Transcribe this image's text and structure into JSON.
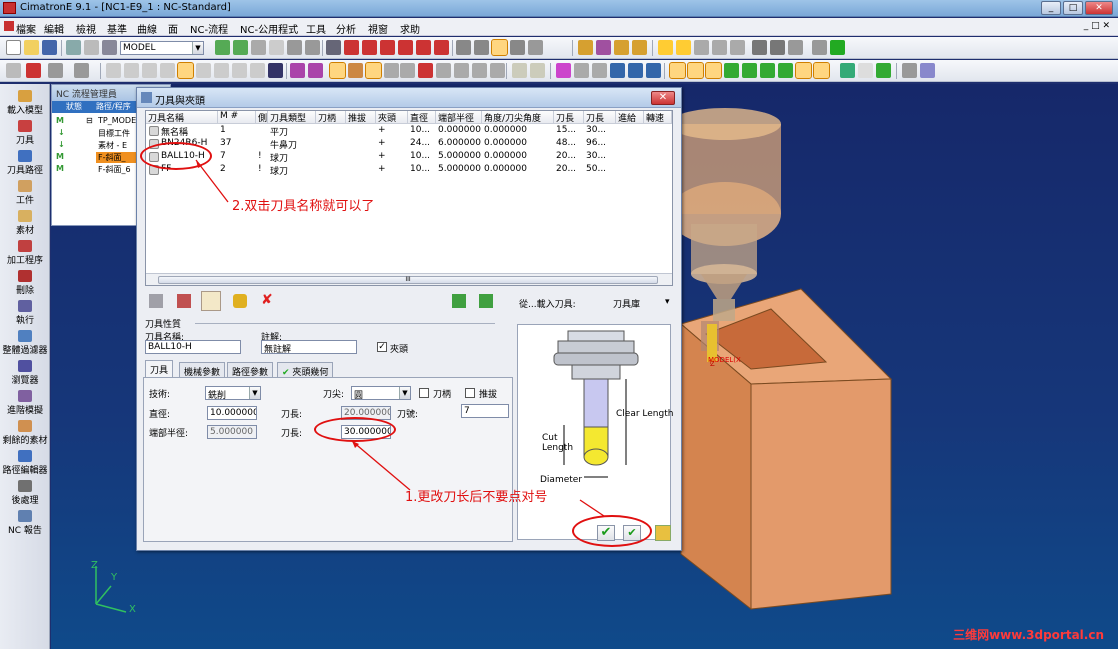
{
  "window": {
    "title": "CimatronE 9.1 - [NC1-E9_1 : NC-Standard]",
    "controls": [
      "_",
      "□",
      "✕"
    ]
  },
  "menu": [
    "檔案",
    "編輯",
    "檢視",
    "基準",
    "曲線",
    "面",
    "NC-流程",
    "NC-公用程式",
    "工具",
    "分析",
    "視窗",
    "求助"
  ],
  "toolbar1": {
    "model_combo": "MODEL"
  },
  "sidebar": [
    {
      "label": "載入模型",
      "icon": "load-model-icon"
    },
    {
      "label": "刀具",
      "icon": "tool-icon"
    },
    {
      "label": "刀具路徑",
      "icon": "toolpath-icon"
    },
    {
      "label": "工件",
      "icon": "stock-icon"
    },
    {
      "label": "素材",
      "icon": "material-icon"
    },
    {
      "label": "加工程序",
      "icon": "procedure-icon"
    },
    {
      "label": "刪除",
      "icon": "delete-icon"
    },
    {
      "label": "執行",
      "icon": "execute-icon"
    },
    {
      "label": "整體過濾器",
      "icon": "filter-icon"
    },
    {
      "label": "瀏覽器",
      "icon": "browser-icon"
    },
    {
      "label": "進階模擬",
      "icon": "simulation-icon"
    },
    {
      "label": "剩餘的素材",
      "icon": "remaining-stock-icon"
    },
    {
      "label": "路徑編輯器",
      "icon": "path-editor-icon"
    },
    {
      "label": "後處理",
      "icon": "post-process-icon"
    },
    {
      "label": "NC 報告",
      "icon": "nc-report-icon"
    }
  ],
  "nc_panel": {
    "title": "NC 流程管理員",
    "columns": [
      "狀態",
      "路徑/程序"
    ],
    "rows": [
      "TP_MODE",
      "目標工件",
      "素材 - E",
      "F-斜面_",
      "F-斜面_6"
    ]
  },
  "dialog": {
    "title": "刀具與夾頭",
    "close": "✕",
    "table": {
      "headers": [
        "刀具名稱",
        "M #",
        "側",
        "刀具類型",
        "刀柄",
        "推拔",
        "夾頭",
        "直徑",
        "端部半徑",
        "角度/刀尖角度",
        "刀長",
        "刀長",
        "進給",
        "轉速"
      ],
      "rows": [
        [
          "無名稱",
          "1",
          "",
          "平刀",
          "",
          "",
          "+",
          "10...",
          "0.000000",
          "0.000000",
          "15...",
          "30...",
          "",
          ""
        ],
        [
          "BN24R6-H",
          "37",
          "",
          "牛鼻刀",
          "",
          "",
          "+",
          "24...",
          "6.000000",
          "0.000000",
          "48...",
          "96...",
          "",
          ""
        ],
        [
          "BALL10-H",
          "7",
          "!",
          "球刀",
          "",
          "",
          "+",
          "10...",
          "5.000000",
          "0.000000",
          "20...",
          "30...",
          "",
          ""
        ],
        [
          "FF",
          "2",
          "!",
          "球刀",
          "",
          "",
          "+",
          "10...",
          "5.000000",
          "0.000000",
          "20...",
          "50...",
          "",
          ""
        ]
      ],
      "scroll_mark": "III"
    },
    "load_from_label": "從...載入刀具:",
    "load_from_value": "刀具庫",
    "props_title": "刀具性質",
    "name_label": "刀具名稱:",
    "name_value": "BALL10-H",
    "comment_label": "註解:",
    "comment_value": "無註解",
    "chuck_label": "夾頭",
    "tabs": [
      "刀具",
      "機械參數",
      "路徑參數",
      "夾頭幾何"
    ],
    "tech_label": "技術:",
    "tech_value": "銑削",
    "tip_label": "刀尖:",
    "tip_value": "圓",
    "shank_label": "刀柄",
    "taper_label": "推拔",
    "diameter_label": "直徑:",
    "diameter_value": "10.000000",
    "length1_label": "刀長:",
    "length1_value": "20.000000",
    "flutes_label": "刀號:",
    "flutes_value": "7",
    "radius_label": "端部半徑:",
    "radius_value": "5.000000",
    "length2_label": "刀長:",
    "length2_value": "30.000000",
    "diagram": {
      "clear_length": "Clear Length",
      "cut_length": "Cut Length",
      "diameter": "Diameter"
    }
  },
  "annotations": {
    "note2": "2.双击刀具名称就可以了",
    "note1": "1.更改刀长后不要点对号"
  },
  "viewport": {
    "axis": [
      "Z",
      "Y",
      "X"
    ],
    "model_label": "MODEL(X"
  },
  "watermark": "三维网www.3dportal.cn"
}
